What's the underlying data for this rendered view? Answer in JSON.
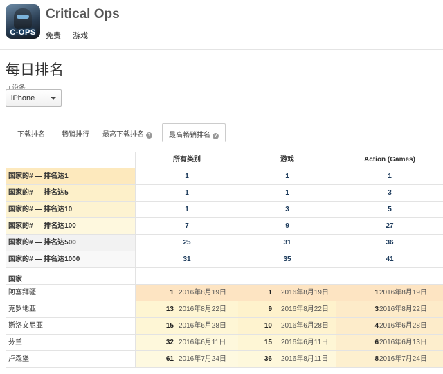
{
  "app": {
    "title": "Critical Ops",
    "icon_text": "C-OPS",
    "price": "免费",
    "category": "游戏"
  },
  "page_title": "每日排名",
  "device": {
    "label": "设备",
    "selected": "iPhone"
  },
  "tabs": [
    {
      "label": "下载排名",
      "help": false
    },
    {
      "label": "畅销排行",
      "help": false
    },
    {
      "label": "最高下载排名",
      "help": true
    },
    {
      "label": "最高畅销排名",
      "help": true,
      "active": true
    }
  ],
  "table": {
    "columns": [
      "所有类别",
      "游戏",
      "Action (Games)"
    ],
    "thresholds": [
      {
        "label": "国家的# — 排名达1",
        "values": [
          "1",
          "1",
          "1"
        ],
        "color": "#fde9bd"
      },
      {
        "label": "国家的# — 排名达5",
        "values": [
          "1",
          "1",
          "3"
        ],
        "color": "#fdf0c9"
      },
      {
        "label": "国家的# — 排名达10",
        "values": [
          "1",
          "3",
          "5"
        ],
        "color": "#fdf3d1"
      },
      {
        "label": "国家的# — 排名达100",
        "values": [
          "7",
          "9",
          "27"
        ],
        "color": "#fef8de"
      },
      {
        "label": "国家的# — 排名达500",
        "values": [
          "25",
          "31",
          "36"
        ],
        "color": "#f2f2f2"
      },
      {
        "label": "国家的# — 排名达1000",
        "values": [
          "31",
          "35",
          "41"
        ],
        "color": "#f8f8f8"
      }
    ],
    "country_header": "国家",
    "countries": [
      {
        "name": "阿塞拜疆",
        "ranks": [
          {
            "rank": "1",
            "date": "2016年8月19日",
            "color": "#fde4c2"
          },
          {
            "rank": "1",
            "date": "2016年8月19日",
            "color": "#fde4c2"
          },
          {
            "rank": "1",
            "date": "2016年8月19日",
            "color": "#fde4c2"
          }
        ]
      },
      {
        "name": "克罗地亚",
        "ranks": [
          {
            "rank": "13",
            "date": "2016年8月22日",
            "color": "#fef5d2"
          },
          {
            "rank": "9",
            "date": "2016年8月22日",
            "color": "#fef2cc"
          },
          {
            "rank": "3",
            "date": "2016年8月22日",
            "color": "#fdebc9"
          }
        ]
      },
      {
        "name": "斯洛文尼亚",
        "ranks": [
          {
            "rank": "15",
            "date": "2016年6月28日",
            "color": "#fef6d5"
          },
          {
            "rank": "10",
            "date": "2016年6月28日",
            "color": "#fef3cf"
          },
          {
            "rank": "4",
            "date": "2016年6月28日",
            "color": "#fdecca"
          }
        ]
      },
      {
        "name": "芬兰",
        "ranks": [
          {
            "rank": "32",
            "date": "2016年6月11日",
            "color": "#fef8dc"
          },
          {
            "rank": "15",
            "date": "2016年6月11日",
            "color": "#fef6d5"
          },
          {
            "rank": "6",
            "date": "2016年6月13日",
            "color": "#fdeecd"
          }
        ]
      },
      {
        "name": "卢森堡",
        "ranks": [
          {
            "rank": "61",
            "date": "2016年7月24日",
            "color": "#fef9e0"
          },
          {
            "rank": "36",
            "date": "2016年8月11日",
            "color": "#fef8dc"
          },
          {
            "rank": "8",
            "date": "2016年7月24日",
            "color": "#fdf0cf"
          }
        ]
      }
    ]
  }
}
